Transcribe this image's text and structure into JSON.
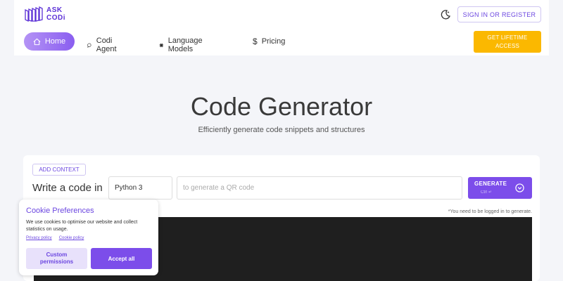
{
  "header": {
    "logo_line1": "ASK",
    "logo_line2": "CODi",
    "sign_in_label": "SIGN IN OR REGISTER",
    "lifetime_line1": "GET LIFETIME",
    "lifetime_line2": "ACCESS",
    "lifetime_color": "#fbb800",
    "accent_color": "#7c4dea"
  },
  "nav": {
    "items": [
      {
        "label": "Home",
        "icon": "home-icon",
        "active": true
      },
      {
        "label": "Codi Agent",
        "icon": "chat-icon"
      },
      {
        "label": "Language Models",
        "icon": "chip-icon"
      },
      {
        "label": "Pricing",
        "icon": "dollar-icon"
      }
    ]
  },
  "hero": {
    "title": "Code Generator",
    "subtitle": "Efficiently generate code snippets and structures"
  },
  "generator": {
    "add_context_label": "ADD CONTEXT",
    "write_label": "Write a code in",
    "language_value": "Python 3",
    "task_placeholder": "to generate a QR code",
    "generate_label": "GENERATE",
    "generate_sub": "Ctrl ↵",
    "login_note": "*You need to be logged in to generate."
  },
  "cookie": {
    "title": "Cookie Preferences",
    "text": "We use cookies to optimise our website and collect statistics on usage.",
    "privacy_link": "Privacy policy",
    "cookie_link": "Cookie policy",
    "custom_line1": "Custom",
    "custom_line2": "permissions",
    "accept_label": "Accept all"
  }
}
